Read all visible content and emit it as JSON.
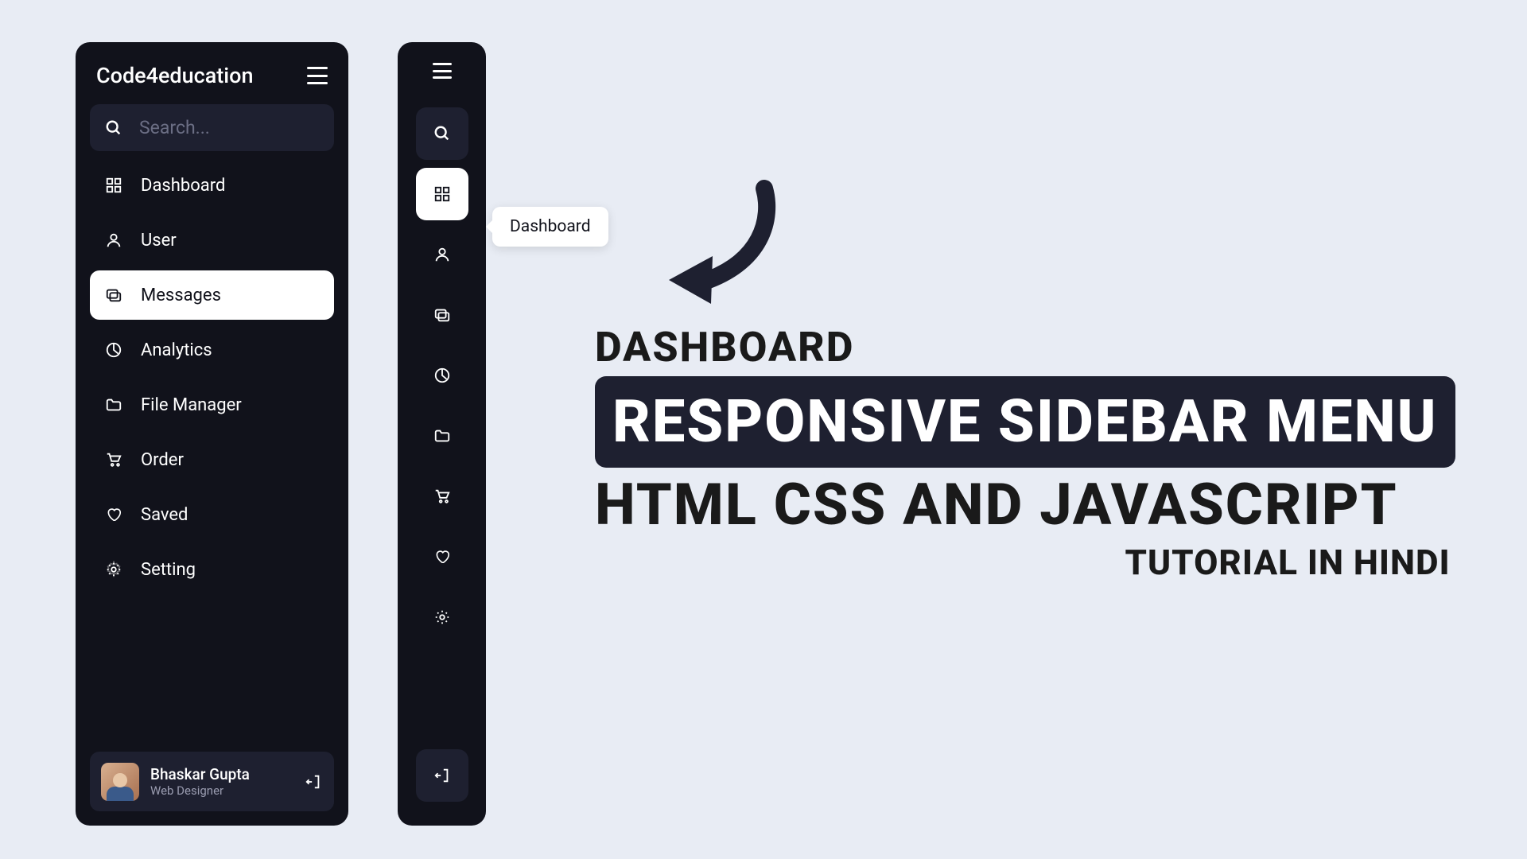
{
  "brand": "Code4education",
  "search": {
    "placeholder": "Search..."
  },
  "nav": {
    "dashboard": "Dashboard",
    "user": "User",
    "messages": "Messages",
    "analytics": "Analytics",
    "filemanager": "File Manager",
    "order": "Order",
    "saved": "Saved",
    "setting": "Setting"
  },
  "profile": {
    "name": "Bhaskar Gupta",
    "role": "Web Designer"
  },
  "tooltip": "Dashboard",
  "hero": {
    "line1": "DASHBOARD",
    "line2": "RESPONSIVE SIDEBAR MENU",
    "line3": "HTML CSS AND JAVASCRIPT",
    "line4": "TUTORIAL IN HINDI"
  }
}
